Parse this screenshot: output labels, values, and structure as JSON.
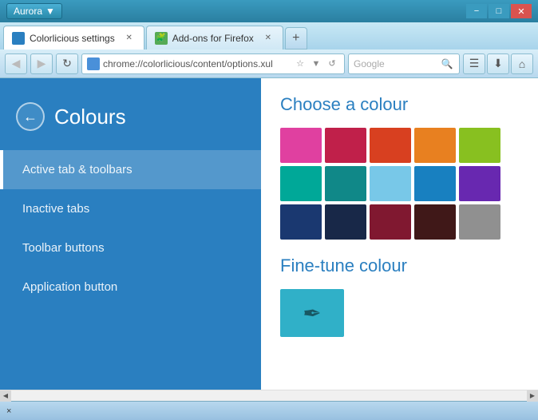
{
  "titleBar": {
    "appName": "Aurora",
    "dropdownArrow": "▼",
    "minimizeLabel": "−",
    "maximizeLabel": "□",
    "closeLabel": "✕"
  },
  "tabs": [
    {
      "label": "Colorlicious settings",
      "active": true,
      "closeable": true
    },
    {
      "label": "Add-ons for Firefox",
      "active": false,
      "closeable": true
    }
  ],
  "newTabLabel": "+",
  "navBar": {
    "backLabel": "◀",
    "forwardLabel": "▶",
    "reloadLabel": "↻",
    "homeLabel": "⌂",
    "addressUrl": "chrome://colorlicious/content/options.xul",
    "bookmarkLabel": "☆",
    "starLabel": "▼",
    "refreshLabel": "↺",
    "searchPlaceholder": "Google",
    "searchIconLabel": "🔍",
    "extrasLabel1": "☰",
    "extrasLabel2": "⬇",
    "extrasLabel3": "⌂"
  },
  "sidebar": {
    "backLabel": "←",
    "title": "Colours",
    "menuItems": [
      {
        "label": "Active tab & toolbars",
        "active": true
      },
      {
        "label": "Inactive tabs",
        "active": false
      },
      {
        "label": "Toolbar buttons",
        "active": false
      },
      {
        "label": "Application button",
        "active": false
      }
    ]
  },
  "content": {
    "chooseTitle": "Choose a colour",
    "swatches": [
      "#e040a0",
      "#c0204a",
      "#d84020",
      "#e88020",
      "#88c020",
      "#00a898",
      "#108888",
      "#78c8e8",
      "#1880c0",
      "#6828b0",
      "#1a3870",
      "#182848",
      "#801830",
      "#401818",
      "#909090"
    ],
    "fineTuneTitle": "Fine-tune colour",
    "fineTuneColor": "#30b0c8",
    "fineTuneIcon": "✒"
  },
  "scrollbar": {
    "leftArrow": "◀",
    "rightArrow": "▶"
  },
  "statusBar": {
    "text": "×"
  }
}
